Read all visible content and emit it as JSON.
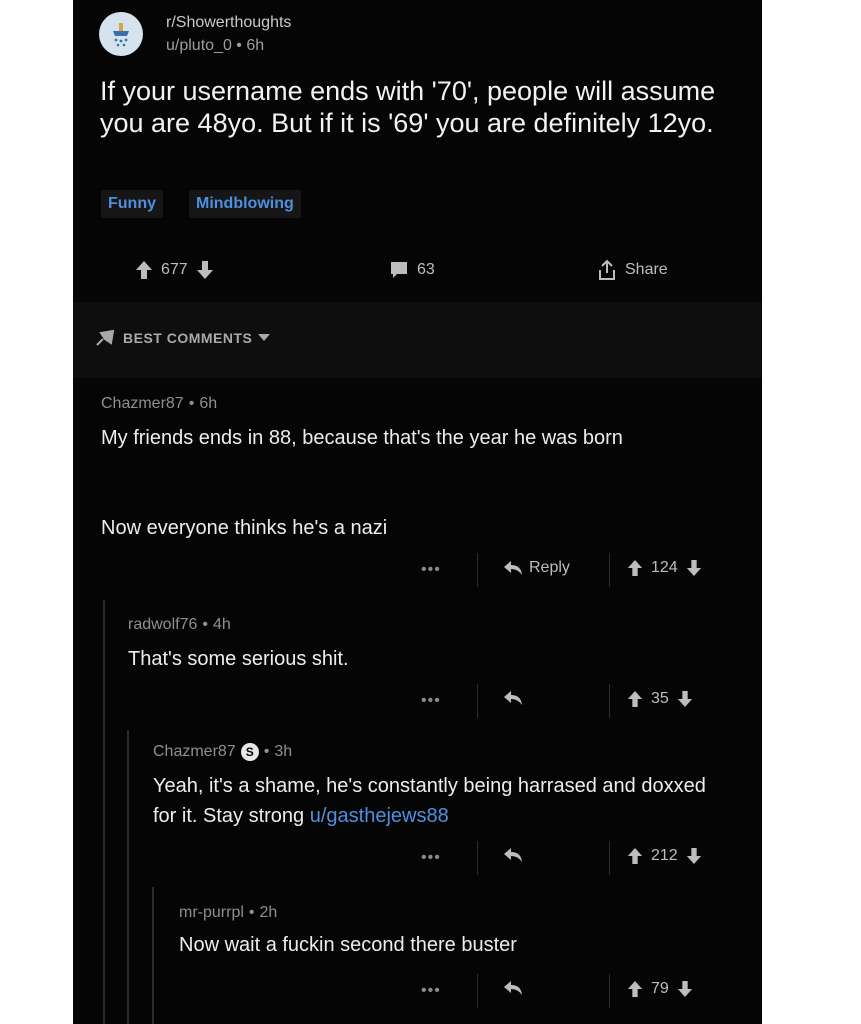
{
  "post": {
    "subreddit": "r/Showerthoughts",
    "author": "u/pluto_0",
    "age": "6h",
    "title": "If your username ends with '70', people will assume you are 48yo. But if it is '69' you are definitely 12yo.",
    "flairs": [
      "Funny",
      "Mindblowing"
    ],
    "upvotes": "677",
    "comments": "63",
    "share_label": "Share"
  },
  "sort": {
    "label": "BEST COMMENTS"
  },
  "comments": [
    {
      "author": "Chazmer87",
      "age": "6h",
      "body_lines": [
        "My friends ends in 88, because that's the year he was born",
        "Now everyone thinks he's a nazi"
      ],
      "reply_label": "Reply",
      "score": "124"
    },
    {
      "author": "radwolf76",
      "age": "4h",
      "body": "That's some serious shit.",
      "score": "35"
    },
    {
      "author": "Chazmer87",
      "badge": "S",
      "age": "3h",
      "body": "Yeah, it's a shame, he's constantly being harrased and doxxed for it.  Stay strong ",
      "link": "u/gasthejews88",
      "score": "212"
    },
    {
      "author": "mr-purrpl",
      "age": "2h",
      "body": "Now wait a fuckin second there buster",
      "score": "79"
    }
  ],
  "dots": "•••",
  "dot_sep": "•",
  "icons": {
    "avatar": "shower-icon",
    "upvote": "up-arrow-icon",
    "downvote": "down-arrow-icon",
    "comment": "speech-bubble-icon",
    "share": "share-icon",
    "reply": "reply-arrow-icon",
    "sort": "rocket-icon",
    "caret": "caret-down-icon"
  },
  "colors": {
    "background": "#050505",
    "link": "#4f8fe0",
    "flair_text": "#4f8fe0"
  }
}
